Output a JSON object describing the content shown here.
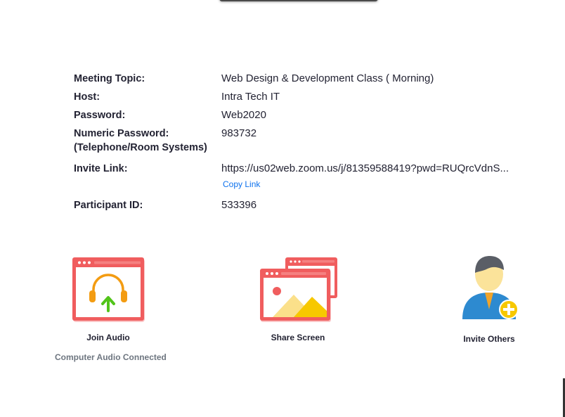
{
  "meeting_info": {
    "topic_label": "Meeting Topic:",
    "topic_value": "Web Design & Development Class ( Morning)",
    "host_label": "Host:",
    "host_value": "Intra Tech IT",
    "password_label": "Password:",
    "password_value": "Web2020",
    "numeric_password_label_line1": "Numeric Password:",
    "numeric_password_label_line2": "(Telephone/Room Systems)",
    "numeric_password_value": "983732",
    "invite_link_label": "Invite Link:",
    "invite_link_value": "https://us02web.zoom.us/j/81359588419?pwd=RUQrcVdnS...",
    "copy_link_label": "Copy Link",
    "participant_id_label": "Participant ID:",
    "participant_id_value": "533396"
  },
  "actions": {
    "join_audio_label": "Join Audio",
    "join_audio_icon": "headphones-upload-icon",
    "share_screen_label": "Share Screen",
    "share_screen_icon": "share-screen-windows-icon",
    "invite_others_label": "Invite Others",
    "invite_others_icon": "add-person-icon"
  },
  "status": {
    "audio_status": "Computer Audio Connected"
  },
  "colors": {
    "accent_red": "#f05d5e",
    "link_blue": "#0e72ed",
    "headphone_orange": "#f39c12",
    "arrow_green": "#52c41a",
    "person_blue": "#2d8ad0",
    "badge_yellow": "#f7c800"
  }
}
